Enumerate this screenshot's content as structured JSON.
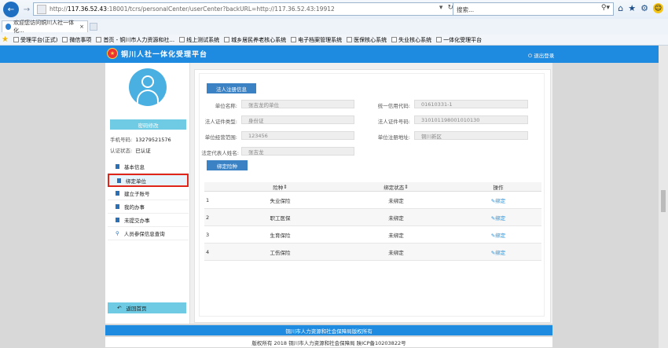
{
  "browser": {
    "url_prefix": "http://",
    "url_host": "117.36.52.43",
    "url_rest": ":18001/tcrs/personalCenter/userCenter?backURL=http://117.36.52.43:19912",
    "search_placeholder": "搜索...",
    "tab_title": "欢迎您访问铜川人社一体化...",
    "favorites": [
      "受理平台(正式)",
      "微信事项",
      "首页 - 铜川市人力资源和社...",
      "线上测试系统",
      "城乡居民养老核心系统",
      "电子档案管理系统",
      "医保核心系统",
      "失业核心系统",
      "一体化受理平台"
    ]
  },
  "header": {
    "title": "铜川人社一体化受理平台",
    "logout": "退出登录"
  },
  "sidebar": {
    "change_password": "密码修改",
    "phone_label": "手机号码:",
    "phone_value": "13279521576",
    "auth_label": "认证状态:",
    "auth_value": "已认证",
    "menu": [
      {
        "label": "基本信息",
        "active": false
      },
      {
        "label": "绑定单位",
        "active": true
      },
      {
        "label": "建立子账号",
        "active": false
      },
      {
        "label": "我的办事",
        "active": false
      },
      {
        "label": "未提交办事",
        "active": false
      },
      {
        "label": "人员参保信息查询",
        "active": false
      }
    ],
    "home_button": "返回首页"
  },
  "legal": {
    "section_title": "法人注册信息",
    "unit_name_label": "单位名称:",
    "unit_name_value": "张吉龙的单位",
    "credit_code_label": "统一信用代码:",
    "credit_code_value": "01610331-1",
    "cert_type_label": "法人证件类型:",
    "cert_type_value": "身份证",
    "cert_no_label": "法人证件号码:",
    "cert_no_value": "310101198001010130",
    "scope_label": "单位经营范围:",
    "scope_value": "123456",
    "address_label": "单位注册地址:",
    "address_value": "铜川新区",
    "rep_label": "法定代表人姓名:",
    "rep_value": "张吉龙"
  },
  "binding": {
    "button": "绑定险种",
    "columns": [
      "",
      "险种",
      "绑定状态",
      "操作"
    ],
    "rows": [
      {
        "no": "1",
        "type": "失业保险",
        "status": "未绑定",
        "op": "绑定"
      },
      {
        "no": "2",
        "type": "职工医保",
        "status": "未绑定",
        "op": "绑定"
      },
      {
        "no": "3",
        "type": "生育保险",
        "status": "未绑定",
        "op": "绑定"
      },
      {
        "no": "4",
        "type": "工伤保险",
        "status": "未绑定",
        "op": "绑定"
      }
    ]
  },
  "footer": {
    "line1": "铜川市人力资源和社会保障局版权所有",
    "line2": "版权所有 2018 铜川市人力资源和社会保障局 陕ICP备10203822号"
  }
}
